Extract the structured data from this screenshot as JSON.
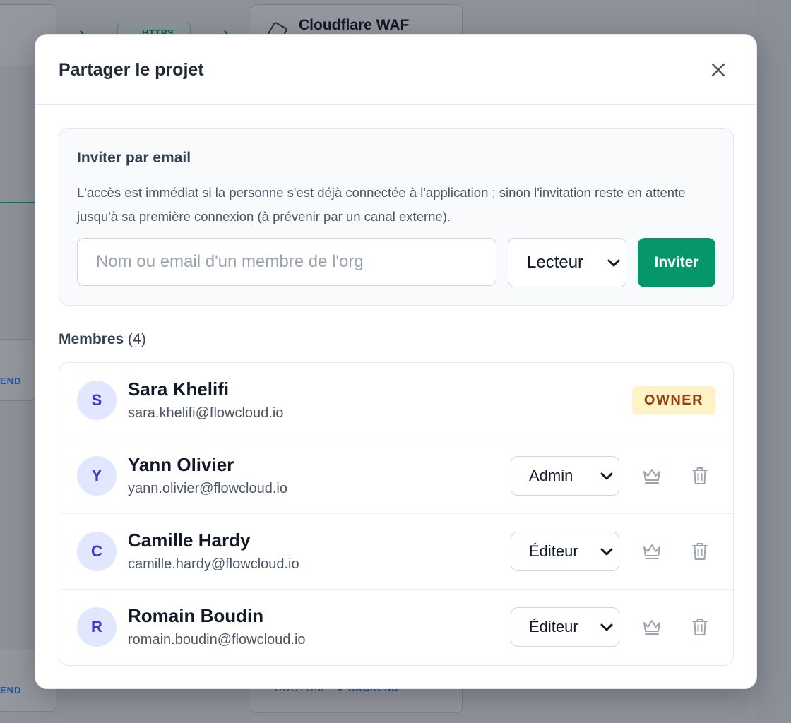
{
  "background": {
    "pill_label": "HTTPS",
    "node_title": "Cloudflare WAF",
    "tag_label": "END",
    "foot_label": "CUSTOM",
    "foot_tag": "BACKEND"
  },
  "modal": {
    "title": "Partager le projet",
    "close_icon": "close-icon"
  },
  "invite": {
    "title": "Inviter par email",
    "description": "L'accès est immédiat si la personne s'est déjà connectée à l'application ; sinon l'invitation reste en attente jusqu'à sa première connexion (à prévenir par un canal externe).",
    "input_placeholder": "Nom ou email d'un membre de l'org",
    "input_value": "",
    "role_selected": "Lecteur",
    "button_label": "Inviter",
    "accent_color": "#059669"
  },
  "members": {
    "heading": "Membres",
    "count": "(4)",
    "list": [
      {
        "initial": "S",
        "name": "Sara Khelifi",
        "email": "sara.khelifi@flowcloud.io",
        "badge": "OWNER"
      },
      {
        "initial": "Y",
        "name": "Yann Olivier",
        "email": "yann.olivier@flowcloud.io",
        "role": "Admin"
      },
      {
        "initial": "C",
        "name": "Camille Hardy",
        "email": "camille.hardy@flowcloud.io",
        "role": "Éditeur"
      },
      {
        "initial": "R",
        "name": "Romain Boudin",
        "email": "romain.boudin@flowcloud.io",
        "role": "Éditeur"
      }
    ]
  }
}
